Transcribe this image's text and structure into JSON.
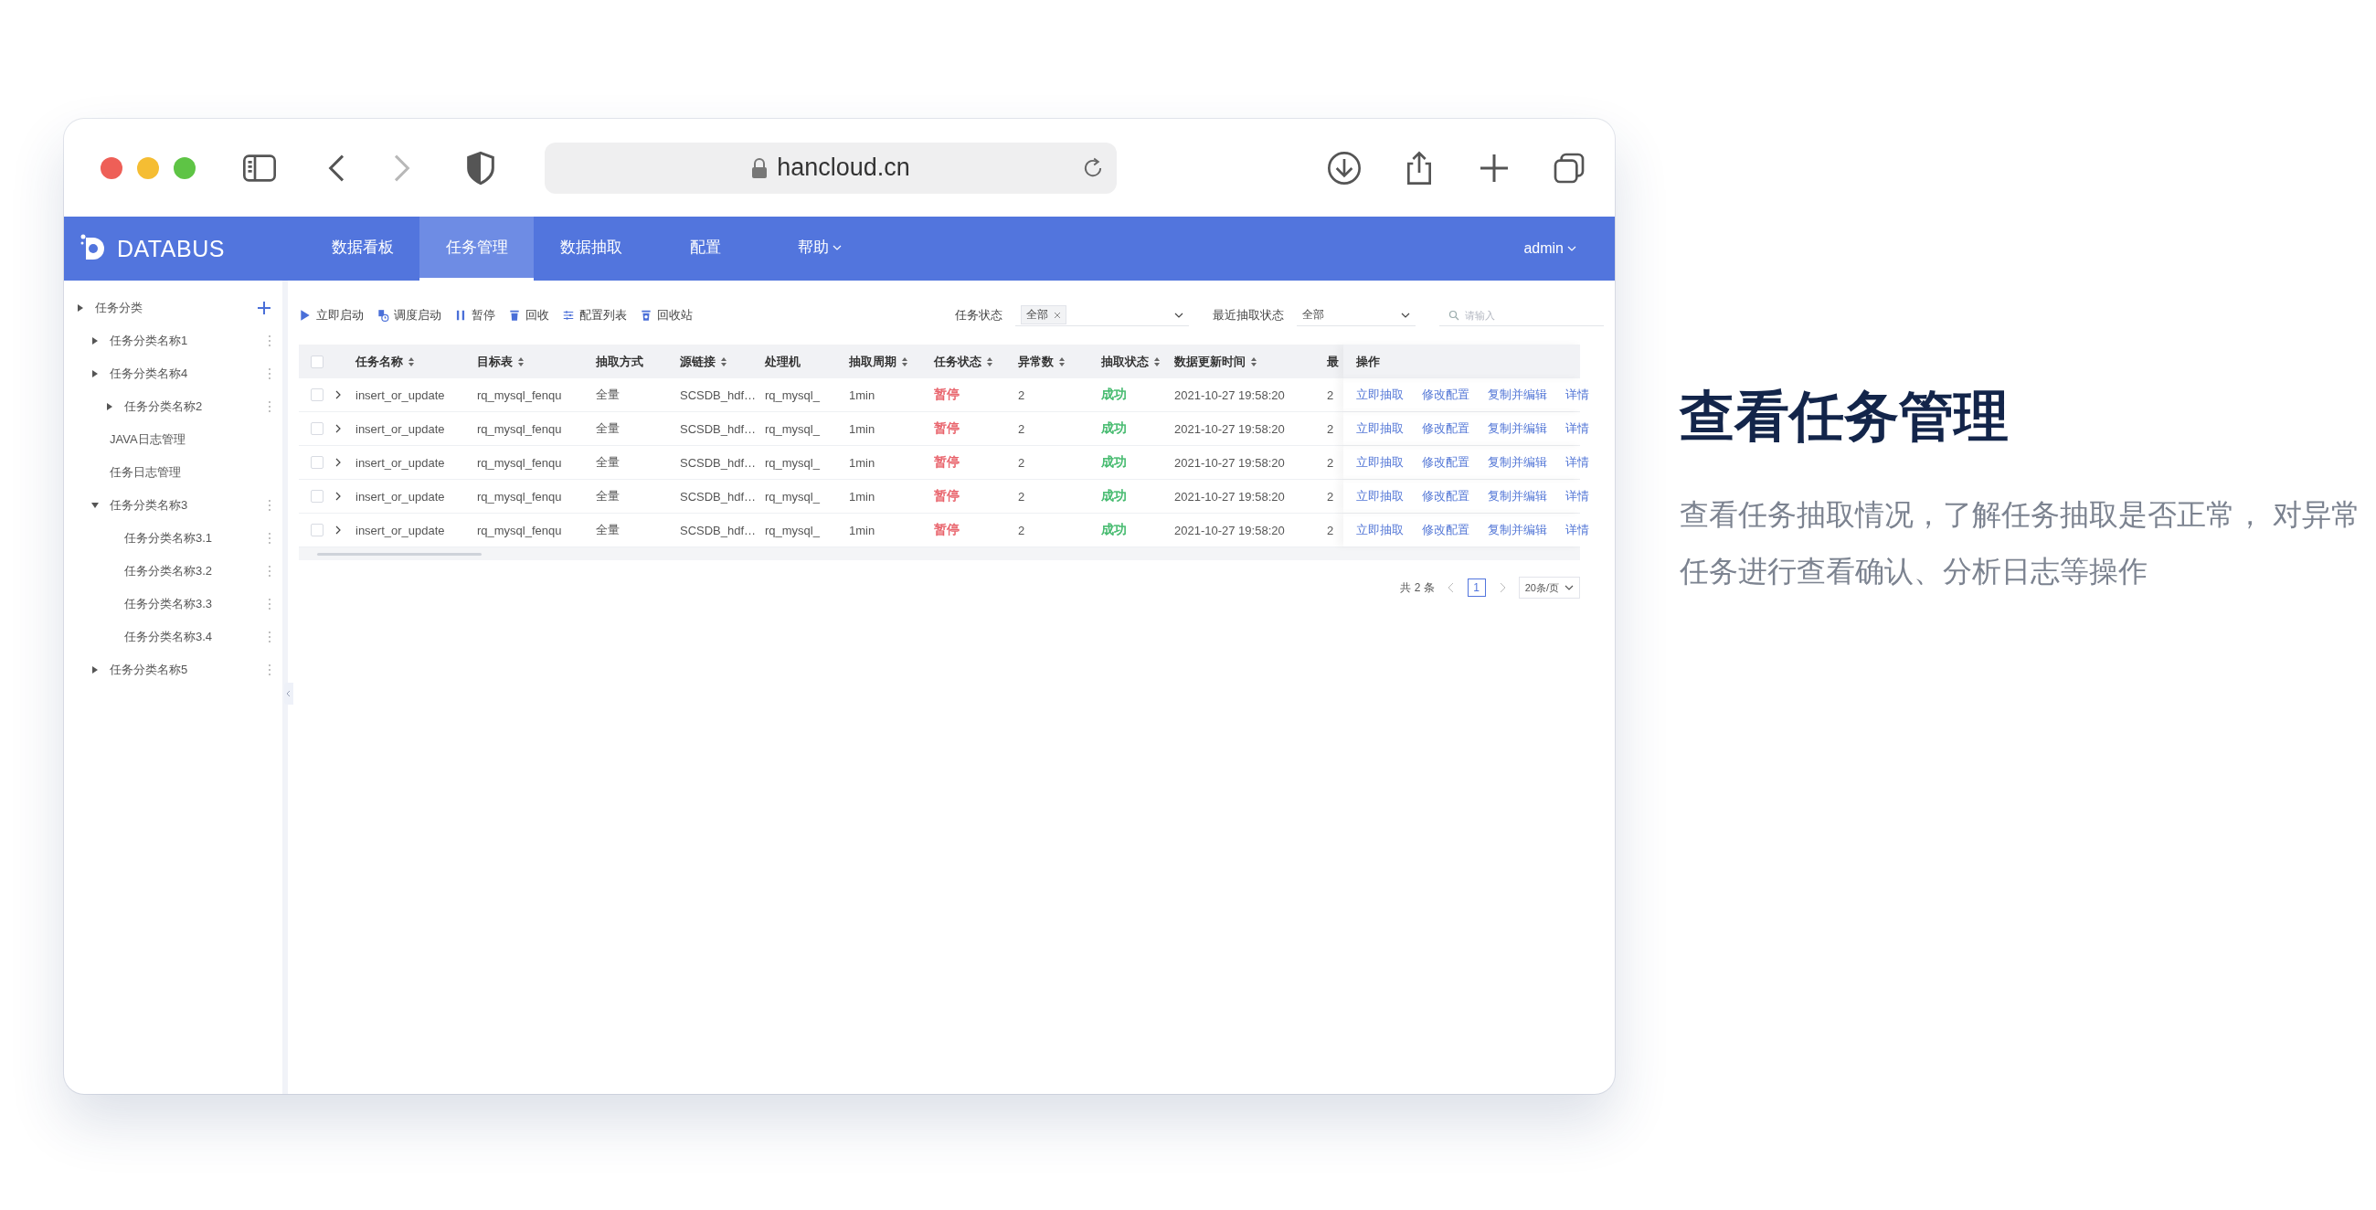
{
  "browser": {
    "url": "hancloud.cn",
    "forward_disabled": true
  },
  "nav": {
    "logo": "DATABUS",
    "tabs": [
      {
        "label": "数据看板",
        "selected": false,
        "dropdown": false
      },
      {
        "label": "任务管理",
        "selected": true,
        "dropdown": false
      },
      {
        "label": "数据抽取",
        "selected": false,
        "dropdown": false
      },
      {
        "label": "配置",
        "selected": false,
        "dropdown": false
      },
      {
        "label": "帮助",
        "selected": false,
        "dropdown": true
      }
    ],
    "user": "admin"
  },
  "sidebar": {
    "title": "任务分类",
    "expanded": false,
    "items": [
      {
        "label": "任务分类名称1",
        "expanded": false,
        "menu": true
      },
      {
        "label": "任务分类名称4",
        "expanded": false,
        "menu": true,
        "children": [
          {
            "label": "任务分类名称2",
            "expanded": false,
            "menu": true
          }
        ]
      },
      {
        "label": "JAVA日志管理",
        "menu": false
      },
      {
        "label": "任务日志管理",
        "menu": false
      },
      {
        "label": "任务分类名称3",
        "expanded": true,
        "menu": true,
        "children": [
          {
            "label": "任务分类名称3.1",
            "menu": true
          },
          {
            "label": "任务分类名称3.2",
            "menu": true
          },
          {
            "label": "任务分类名称3.3",
            "menu": true
          },
          {
            "label": "任务分类名称3.4",
            "menu": true
          }
        ]
      },
      {
        "label": "任务分类名称5",
        "expanded": false,
        "menu": true
      }
    ]
  },
  "toolbar": {
    "buttons": [
      "立即启动",
      "调度启动",
      "暂停",
      "回收",
      "配置列表",
      "回收站"
    ]
  },
  "filters": {
    "task_status": {
      "label": "任务状态",
      "tag": "全部"
    },
    "extract_status": {
      "label": "最近抽取状态",
      "value": "全部"
    },
    "search": {
      "placeholder": "请输入"
    }
  },
  "table": {
    "all_checked": false,
    "columns": [
      {
        "label": "任务名称",
        "sortable": true
      },
      {
        "label": "目标表",
        "sortable": true
      },
      {
        "label": "抽取方式",
        "sortable": false
      },
      {
        "label": "源链接",
        "sortable": true
      },
      {
        "label": "处理机",
        "sortable": false
      },
      {
        "label": "抽取周期",
        "sortable": true
      },
      {
        "label": "任务状态",
        "sortable": true
      },
      {
        "label": "异常数",
        "sortable": true
      },
      {
        "label": "抽取状态",
        "sortable": true
      },
      {
        "label": "数据更新时间",
        "sortable": true
      },
      {
        "label": "最",
        "sortable": false
      },
      {
        "label": "操作",
        "sortable": false
      }
    ],
    "rows": [
      {
        "checked": false,
        "expanded": false,
        "cells": [
          {
            "text": "insert_or_update"
          },
          {
            "text": "rq_mysql_fenqu"
          },
          {
            "text": "全量"
          },
          {
            "text": "SCSDB_hdf…"
          },
          {
            "text": "rq_mysql_"
          },
          {
            "text": "1min"
          },
          {
            "text": "暂停",
            "color": "#e8616a"
          },
          {
            "text": "2"
          },
          {
            "text": "成功",
            "color": "#3fb86a"
          },
          {
            "text": "2021-10-27 19:58:20"
          },
          {
            "text": "2"
          }
        ],
        "actions": [
          "立即抽取",
          "修改配置",
          "复制并编辑",
          "详情"
        ]
      },
      {
        "checked": false,
        "expanded": false,
        "cells": [
          {
            "text": "insert_or_update"
          },
          {
            "text": "rq_mysql_fenqu"
          },
          {
            "text": "全量"
          },
          {
            "text": "SCSDB_hdf…"
          },
          {
            "text": "rq_mysql_"
          },
          {
            "text": "1min"
          },
          {
            "text": "暂停",
            "color": "#e8616a"
          },
          {
            "text": "2"
          },
          {
            "text": "成功",
            "color": "#3fb86a"
          },
          {
            "text": "2021-10-27 19:58:20"
          },
          {
            "text": "2"
          }
        ],
        "actions": [
          "立即抽取",
          "修改配置",
          "复制并编辑",
          "详情"
        ]
      },
      {
        "checked": false,
        "expanded": false,
        "cells": [
          {
            "text": "insert_or_update"
          },
          {
            "text": "rq_mysql_fenqu"
          },
          {
            "text": "全量"
          },
          {
            "text": "SCSDB_hdf…"
          },
          {
            "text": "rq_mysql_"
          },
          {
            "text": "1min"
          },
          {
            "text": "暂停",
            "color": "#e8616a"
          },
          {
            "text": "2"
          },
          {
            "text": "成功",
            "color": "#3fb86a"
          },
          {
            "text": "2021-10-27 19:58:20"
          },
          {
            "text": "2"
          }
        ],
        "actions": [
          "立即抽取",
          "修改配置",
          "复制并编辑",
          "详情"
        ]
      },
      {
        "checked": false,
        "expanded": false,
        "cells": [
          {
            "text": "insert_or_update"
          },
          {
            "text": "rq_mysql_fenqu"
          },
          {
            "text": "全量"
          },
          {
            "text": "SCSDB_hdf…"
          },
          {
            "text": "rq_mysql_"
          },
          {
            "text": "1min"
          },
          {
            "text": "暂停",
            "color": "#e8616a"
          },
          {
            "text": "2"
          },
          {
            "text": "成功",
            "color": "#3fb86a"
          },
          {
            "text": "2021-10-27 19:58:20"
          },
          {
            "text": "2"
          }
        ],
        "actions": [
          "立即抽取",
          "修改配置",
          "复制并编辑",
          "详情"
        ]
      },
      {
        "checked": false,
        "expanded": false,
        "cells": [
          {
            "text": "insert_or_update"
          },
          {
            "text": "rq_mysql_fenqu"
          },
          {
            "text": "全量"
          },
          {
            "text": "SCSDB_hdf…"
          },
          {
            "text": "rq_mysql_"
          },
          {
            "text": "1min"
          },
          {
            "text": "暂停",
            "color": "#e8616a"
          },
          {
            "text": "2"
          },
          {
            "text": "成功",
            "color": "#3fb86a"
          },
          {
            "text": "2021-10-27 19:58:20"
          },
          {
            "text": "2"
          }
        ],
        "actions": [
          "立即抽取",
          "修改配置",
          "复制并编辑",
          "详情"
        ]
      }
    ]
  },
  "pagination": {
    "total": "共 2 条",
    "pages": [
      {
        "label": "1",
        "selected": true
      }
    ],
    "page_size": "20条/页"
  },
  "headline": {
    "title": "查看任务管理",
    "description": "查看任务抽取情况，了解任务抽取是否正常， 对异常任务进行查看确认、分析日志等操作"
  }
}
